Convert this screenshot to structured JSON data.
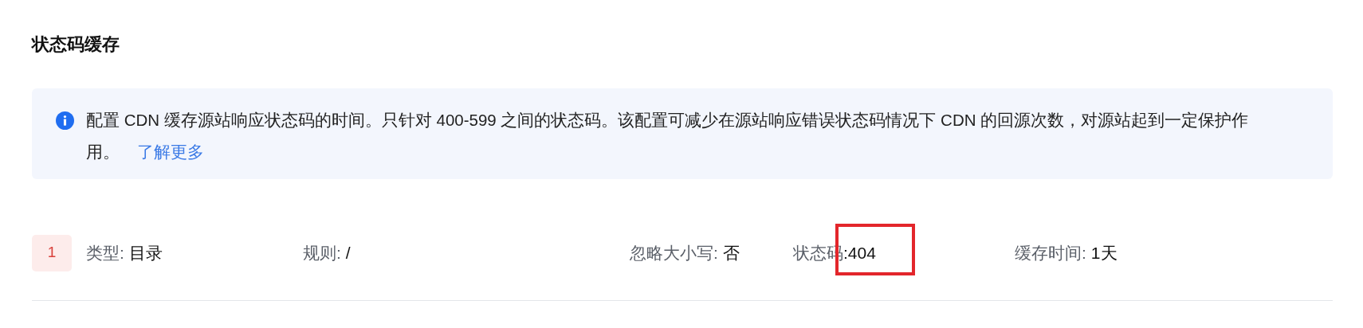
{
  "title": "状态码缓存",
  "alert": {
    "text": "配置 CDN 缓存源站响应状态码的时间。只针对 400-599 之间的状态码。该配置可减少在源站响应错误状态码情况下 CDN 的回源次数，对源站起到一定保护作用。",
    "link": "了解更多"
  },
  "rules": [
    {
      "index": "1",
      "fields": [
        {
          "label": "类型:",
          "value": "目录",
          "highlighted": false
        },
        {
          "label": "规则:",
          "value": "/",
          "highlighted": false
        },
        {
          "label": "忽略大小写:",
          "value": "否",
          "highlighted": false
        },
        {
          "label": "状态码",
          "value": ":404",
          "highlighted": true
        },
        {
          "label": "缓存时间:",
          "value": "1天",
          "highlighted": false
        }
      ]
    }
  ]
}
